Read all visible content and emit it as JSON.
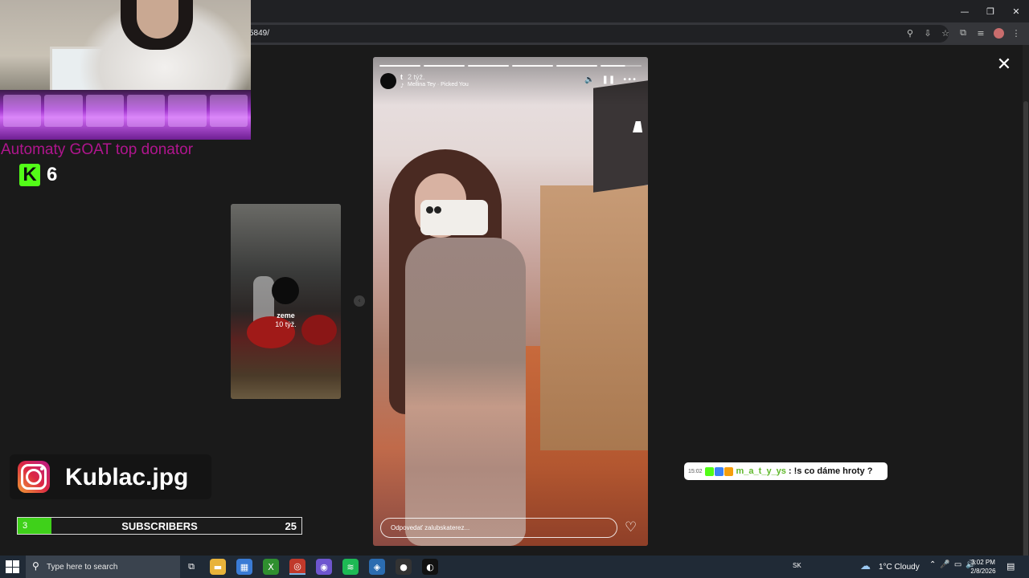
{
  "browser": {
    "url_fragment": "5849/",
    "window_controls": {
      "minimize": "—",
      "restore": "❐",
      "close": "✕"
    },
    "toolbar_icons": [
      "zoom-icon",
      "install-icon",
      "star-icon",
      "extensions-icon",
      "media-icon",
      "profile-avatar",
      "menu-icon"
    ],
    "toolbar_glyphs": {
      "zoom": "⚲",
      "install": "⇩",
      "star": "☆",
      "extensions": "⧉",
      "media": "≡",
      "menu": "⋮"
    }
  },
  "viewer": {
    "close_glyph": "✕",
    "prev_glyph": "‹"
  },
  "stream_overlay": {
    "donator_text": "Automaty GOAT top donator",
    "kick_logo": "K",
    "kick_count": "6",
    "instagram_handle": "Kublac.jpg",
    "subscribers": {
      "current": "3",
      "label": "SUBSCRIBERS",
      "goal": "25",
      "fill_fraction": 0.12
    },
    "chat": {
      "time": "15:02",
      "username": "m_a_t_y_ys",
      "message": ": !s co dáme hroty ?",
      "badge_colors": [
        "#53fc18",
        "#3b82f6",
        "#f59e0b"
      ]
    }
  },
  "side_story": {
    "username": "zeme",
    "time": "10 týž."
  },
  "story": {
    "username": "t",
    "time": "2 týž.",
    "music_icon": "♪",
    "music": "Mellina Tey · Picked You",
    "segments_total": 6,
    "segments_done": 5,
    "controls": {
      "mute": "🔈",
      "pause": "❚❚",
      "more": "•••"
    },
    "reply_placeholder": "Odpovedať zalubskaterez...",
    "like_glyph": "♡"
  },
  "taskbar": {
    "search_icon": "⚲",
    "search_placeholder": "Type here to search",
    "apps": [
      {
        "name": "task-view-icon",
        "glyph": "⧉",
        "color": "transparent"
      },
      {
        "name": "file-explorer-icon",
        "glyph": "▬",
        "color": "#e8b33a"
      },
      {
        "name": "store-icon",
        "glyph": "▦",
        "color": "#3a7bd5"
      },
      {
        "name": "xbox-icon",
        "glyph": "X",
        "color": "#2f8f2f"
      },
      {
        "name": "chrome-icon",
        "glyph": "◎",
        "color": "#c0392b"
      },
      {
        "name": "messenger-icon",
        "glyph": "◉",
        "color": "#6e56cf"
      },
      {
        "name": "spotify-icon",
        "glyph": "≋",
        "color": "#1db954"
      },
      {
        "name": "shield-icon",
        "glyph": "◈",
        "color": "#2b6cb0"
      },
      {
        "name": "obs-icon",
        "glyph": "●",
        "color": "#333333"
      },
      {
        "name": "app-icon",
        "glyph": "◐",
        "color": "#111111"
      }
    ],
    "language": "SK",
    "weather_icon": "☁",
    "weather": "1°C  Cloudy",
    "tray": {
      "chevron": "⌃",
      "mic": "🎤",
      "network": "▭",
      "volume": "🔊"
    },
    "time": "3:02 PM",
    "date": "2/8/2026",
    "notification_icon": "▤"
  }
}
